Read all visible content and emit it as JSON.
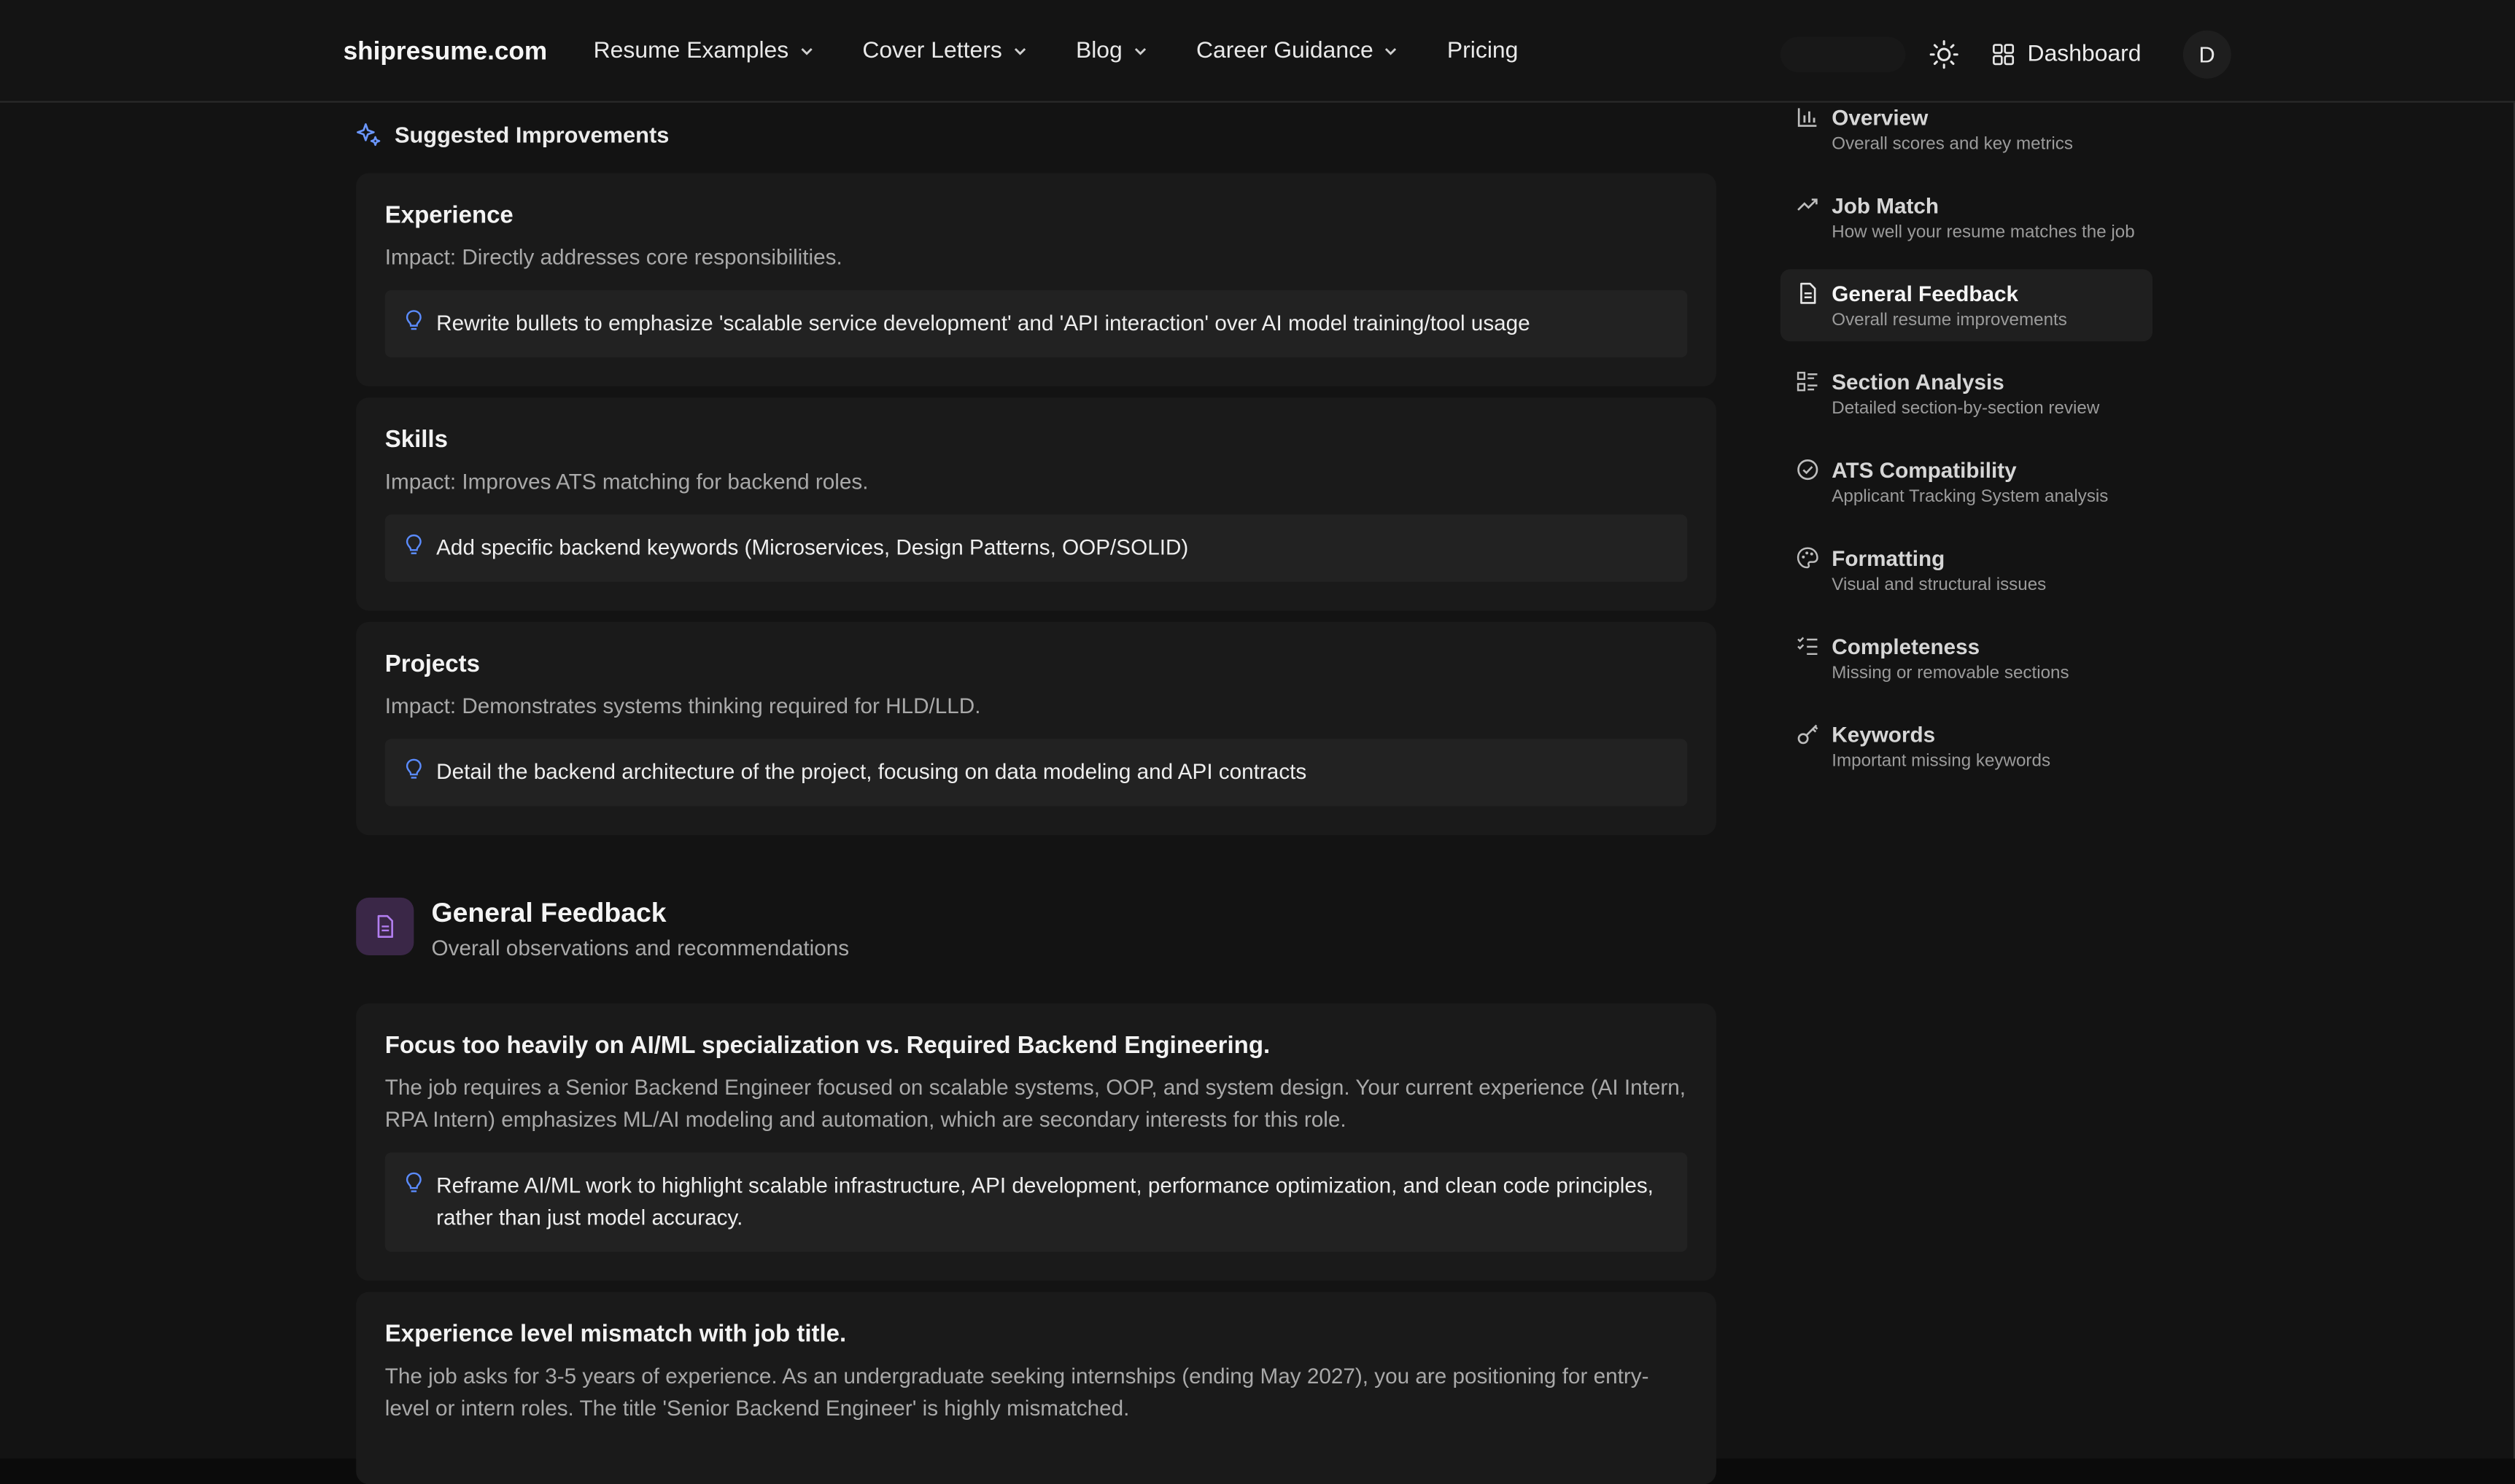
{
  "brand": "shipresume.com",
  "nav": {
    "items": [
      {
        "label": "Resume Examples",
        "dropdown": true
      },
      {
        "label": "Cover Letters",
        "dropdown": true
      },
      {
        "label": "Blog",
        "dropdown": true
      },
      {
        "label": "Career Guidance",
        "dropdown": true
      },
      {
        "label": "Pricing",
        "dropdown": false
      }
    ],
    "dashboard_label": "Dashboard",
    "avatar_initial": "D",
    "theme_icon": "sun-icon"
  },
  "suggested": {
    "heading": "Suggested Improvements",
    "cards": [
      {
        "title": "Experience",
        "impact": "Impact: Directly addresses core responsibilities.",
        "tip": "Rewrite bullets to emphasize 'scalable service development' and 'API interaction' over AI model training/tool usage"
      },
      {
        "title": "Skills",
        "impact": "Impact: Improves ATS matching for backend roles.",
        "tip": "Add specific backend keywords (Microservices, Design Patterns, OOP/SOLID)"
      },
      {
        "title": "Projects",
        "impact": "Impact: Demonstrates systems thinking required for HLD/LLD.",
        "tip": "Detail the backend architecture of the project, focusing on data modeling and API contracts"
      }
    ]
  },
  "general_feedback": {
    "title": "General Feedback",
    "subtitle": "Overall observations and recommendations",
    "cards": [
      {
        "title": "Focus too heavily on AI/ML specialization vs. Required Backend Engineering.",
        "desc": "The job requires a Senior Backend Engineer focused on scalable systems, OOP, and system design. Your current experience (AI Intern, RPA Intern) emphasizes ML/AI modeling and automation, which are secondary interests for this role.",
        "tip": "Reframe AI/ML work to highlight scalable infrastructure, API development, performance optimization, and clean code principles, rather than just model accuracy."
      },
      {
        "title": "Experience level mismatch with job title.",
        "desc": "The job asks for 3-5 years of experience. As an undergraduate seeking internships (ending May 2027), you are positioning for entry-level or intern roles. The title 'Senior Backend Engineer' is highly mismatched."
      }
    ]
  },
  "sidebar": {
    "items": [
      {
        "label": "Overview",
        "desc": "Overall scores and key metrics",
        "icon": "bar-chart-icon"
      },
      {
        "label": "Job Match",
        "desc": "How well your resume matches the job",
        "icon": "trending-up-icon"
      },
      {
        "label": "General Feedback",
        "desc": "Overall resume improvements",
        "icon": "document-icon",
        "active": true
      },
      {
        "label": "Section Analysis",
        "desc": "Detailed section-by-section review",
        "icon": "list-icon"
      },
      {
        "label": "ATS Compatibility",
        "desc": "Applicant Tracking System analysis",
        "icon": "check-circle-icon"
      },
      {
        "label": "Formatting",
        "desc": "Visual and structural issues",
        "icon": "palette-icon"
      },
      {
        "label": "Completeness",
        "desc": "Missing or removable sections",
        "icon": "checklist-icon"
      },
      {
        "label": "Keywords",
        "desc": "Important missing keywords",
        "icon": "key-icon"
      }
    ]
  }
}
